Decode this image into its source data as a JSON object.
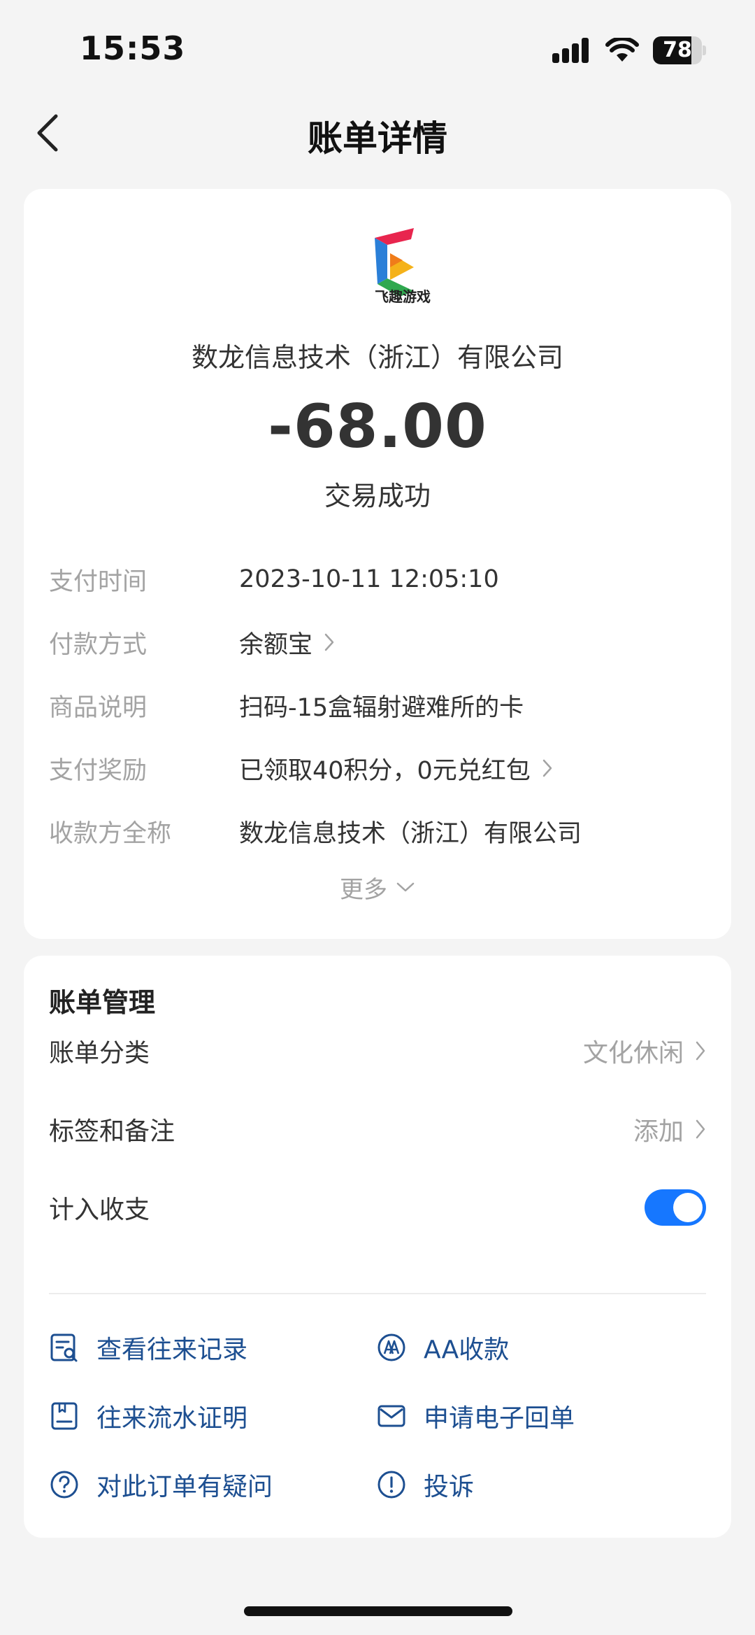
{
  "status_bar": {
    "time": "15:53",
    "battery_level": "78",
    "battery_fraction": 0.78
  },
  "nav": {
    "title": "账单详情"
  },
  "merchant": {
    "logo_text": "飞趣游戏",
    "name": "数龙信息技术（浙江）有限公司"
  },
  "transaction": {
    "amount": "-68.00",
    "status": "交易成功"
  },
  "details": [
    {
      "label": "支付时间",
      "value": "2023-10-11 12:05:10"
    },
    {
      "label": "付款方式",
      "value": "余额宝"
    },
    {
      "label": "商品说明",
      "value": "扫码-15盒辐射避难所的卡"
    },
    {
      "label": "支付奖励",
      "value": "已领取40积分，0元兑红包"
    },
    {
      "label": "收款方全称",
      "value": "数龙信息技术（浙江）有限公司"
    }
  ],
  "more_label": "更多",
  "management": {
    "title": "账单管理",
    "category": {
      "label": "账单分类",
      "value": "文化休闲"
    },
    "tags": {
      "label": "标签和备注",
      "value": "添加"
    },
    "include": {
      "label": "计入收支",
      "enabled": true
    }
  },
  "actions": [
    {
      "label": "查看往来记录",
      "icon": "records-icon"
    },
    {
      "label": "AA收款",
      "icon": "aa-icon"
    },
    {
      "label": "往来流水证明",
      "icon": "statement-icon"
    },
    {
      "label": "申请电子回单",
      "icon": "mail-icon"
    },
    {
      "label": "对此订单有疑问",
      "icon": "question-icon"
    },
    {
      "label": "投诉",
      "icon": "exclamation-icon"
    }
  ],
  "colors": {
    "accent": "#1677ff",
    "action_text": "#1d4f91",
    "muted": "#a3a3a3"
  }
}
